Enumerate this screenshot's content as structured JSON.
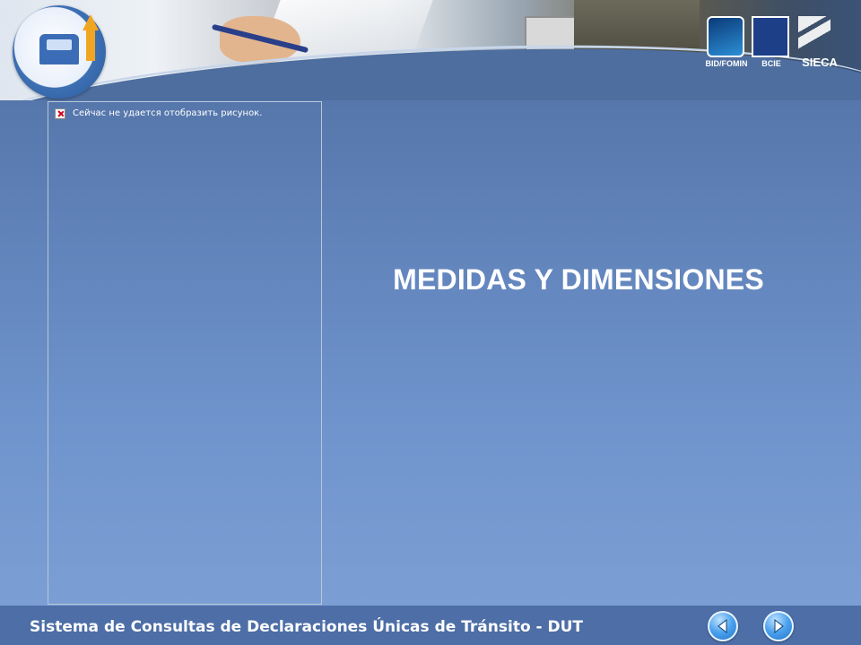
{
  "image_error": {
    "icon": "broken-image-icon",
    "text": "Сейчас не удается отобразить рисунок."
  },
  "slide": {
    "title": "MEDIDAS Y DIMENSIONES"
  },
  "header": {
    "logo_icon": "customs-program-logo-icon",
    "orgs": [
      {
        "label": "BID/FOMIN",
        "icon": "bid-fomin-logo-icon"
      },
      {
        "label": "BCIE",
        "icon": "bcie-logo-icon"
      },
      {
        "label": "SIECA",
        "icon": "sieca-logo-icon"
      }
    ]
  },
  "footer": {
    "text": "Sistema de Consultas de Declaraciones Únicas de Tránsito - DUT",
    "prev_icon": "arrow-left-icon",
    "next_icon": "arrow-right-icon"
  },
  "colors": {
    "background": "#5d7fb6",
    "footer": "#4d6ea6",
    "nav_button": "#2e86de",
    "text": "#ffffff"
  }
}
